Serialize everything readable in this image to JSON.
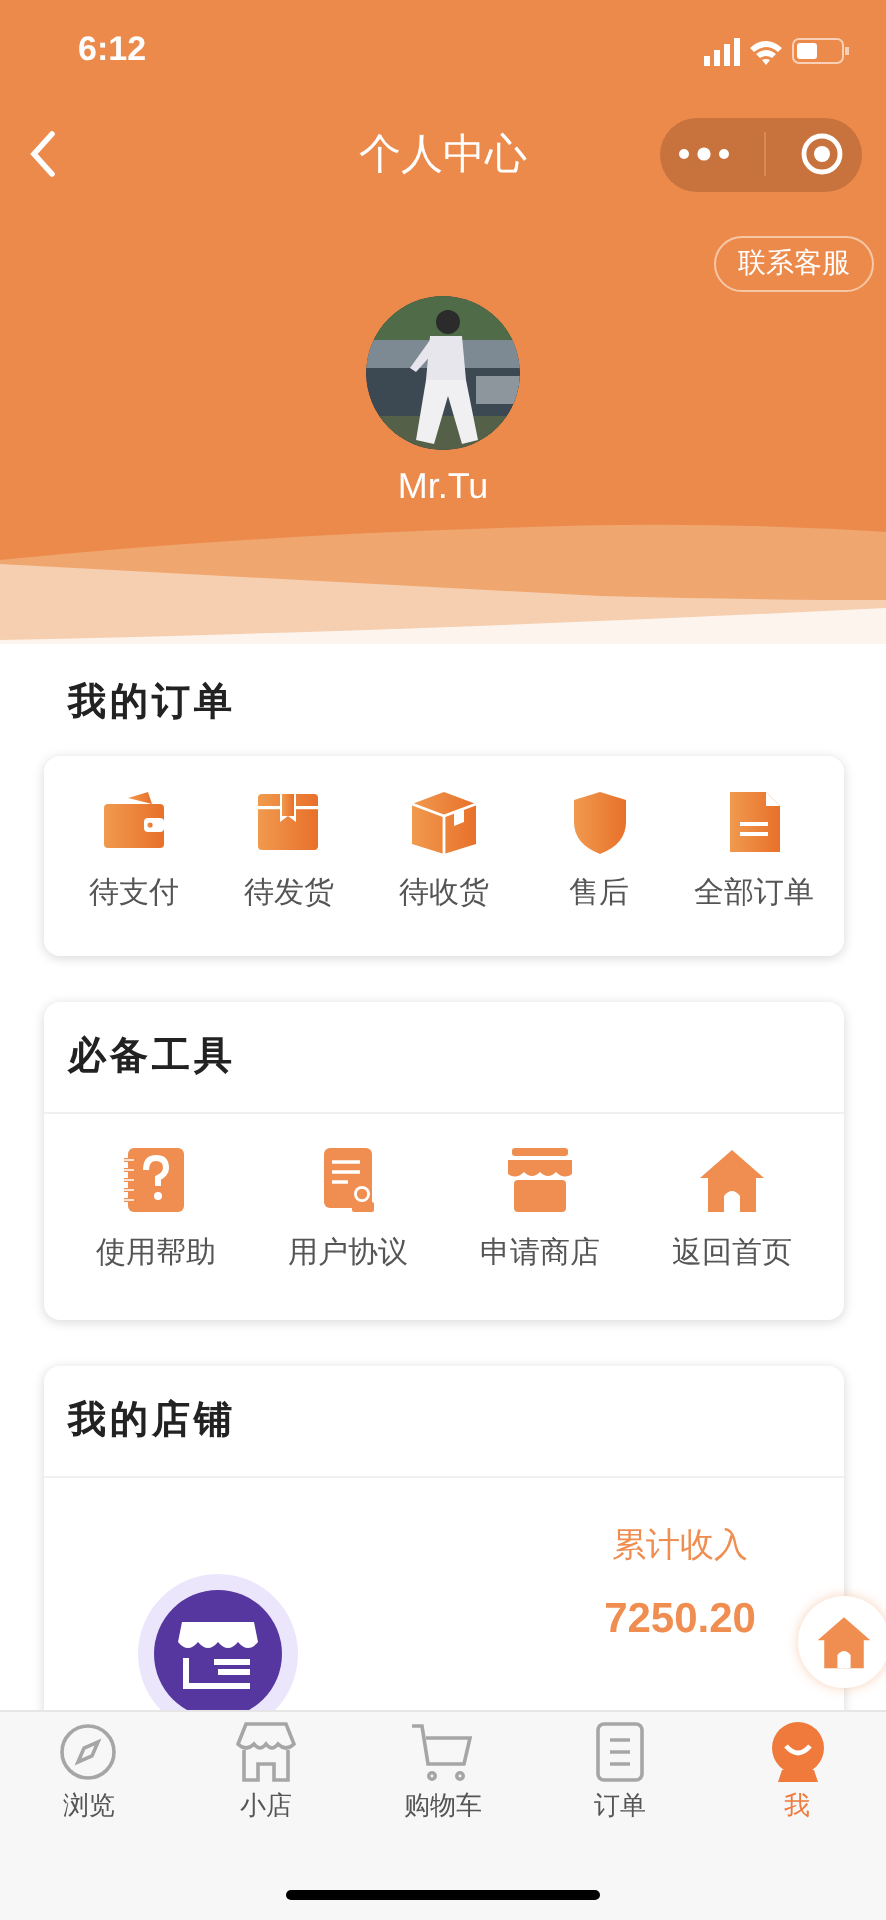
{
  "status_bar": {
    "time": "6:12"
  },
  "nav": {
    "title": "个人中心"
  },
  "header": {
    "contact_button": "联系客服",
    "user_name": "Mr.Tu"
  },
  "orders": {
    "title": "我的订单",
    "items": [
      {
        "label": "待支付",
        "kind": "wallet"
      },
      {
        "label": "待发货",
        "kind": "parcel"
      },
      {
        "label": "待收货",
        "kind": "box"
      },
      {
        "label": "售后",
        "kind": "shield"
      },
      {
        "label": "全部订单",
        "kind": "document"
      }
    ]
  },
  "tools": {
    "title": "必备工具",
    "items": [
      {
        "label": "使用帮助",
        "kind": "help"
      },
      {
        "label": "用户协议",
        "kind": "agreement"
      },
      {
        "label": "申请商店",
        "kind": "store"
      },
      {
        "label": "返回首页",
        "kind": "home"
      }
    ]
  },
  "shop": {
    "title": "我的店铺",
    "income_label": "累计收入",
    "income_value": "7250.20"
  },
  "tab_bar": [
    {
      "label": "浏览",
      "kind": "compass",
      "selected": false
    },
    {
      "label": "小店",
      "kind": "shop",
      "selected": false
    },
    {
      "label": "购物车",
      "kind": "cart",
      "selected": false
    },
    {
      "label": "订单",
      "kind": "list",
      "selected": false
    },
    {
      "label": "我",
      "kind": "me",
      "selected": true
    }
  ]
}
